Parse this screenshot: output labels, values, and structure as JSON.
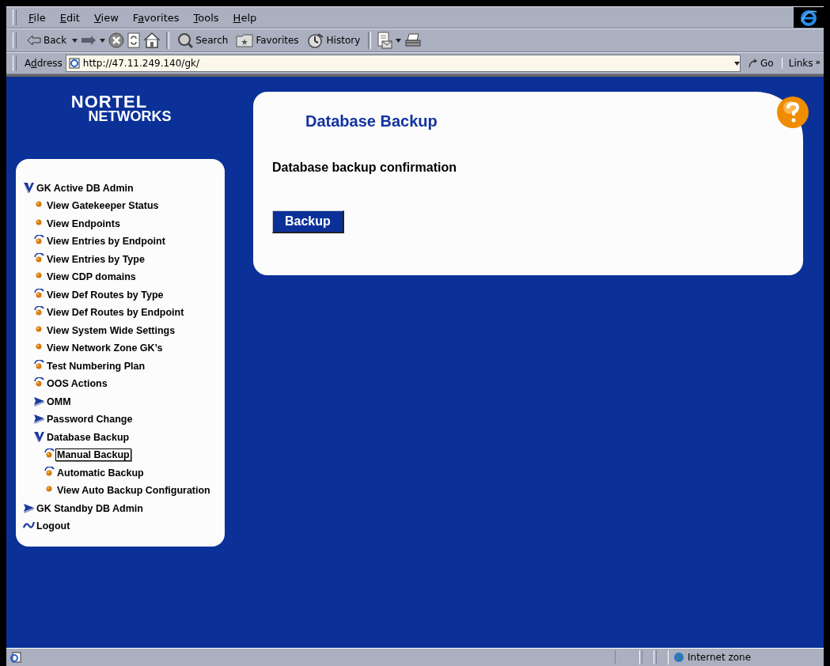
{
  "menu_bar": [
    {
      "access_key": "F",
      "rest": "ile"
    },
    {
      "access_key": "E",
      "rest": "dit"
    },
    {
      "access_key": "V",
      "rest": "iew"
    },
    {
      "before": "F",
      "access_key": "a",
      "rest": "vorites"
    },
    {
      "access_key": "T",
      "rest": "ools"
    },
    {
      "access_key": "H",
      "rest": "elp"
    }
  ],
  "toolbar": [
    {
      "kind": "back",
      "label": "Back"
    },
    {
      "kind": "forward"
    },
    {
      "kind": "stop"
    },
    {
      "kind": "refresh"
    },
    {
      "kind": "home"
    },
    {
      "kind": "separator"
    },
    {
      "kind": "search",
      "label": "Search"
    },
    {
      "kind": "favorites",
      "label": "Favorites"
    },
    {
      "kind": "history",
      "label": "History"
    },
    {
      "kind": "separator"
    },
    {
      "kind": "mail"
    },
    {
      "kind": "print"
    }
  ],
  "address_bar": {
    "before": "A",
    "access_key": "d",
    "rest": "dress",
    "value": "http://47.11.249.140/gk/",
    "go": "Go",
    "links": "Links",
    "links_more": "»"
  },
  "logo": {
    "line_1": "NORTEL",
    "line_2": "NETWORKS"
  },
  "nav": [
    {
      "label": "GK Active DB Admin",
      "kind": "folder",
      "expanded": true,
      "selected": false,
      "children": [
        {
          "label": "View Gatekeeper Status",
          "kind": "bullet",
          "selected": false
        },
        {
          "label": "View Endpoints",
          "kind": "bullet",
          "selected": false
        },
        {
          "label": "View Entries by Endpoint",
          "kind": "bullet-arc",
          "selected": false
        },
        {
          "label": "View Entries by Type",
          "kind": "bullet-arc",
          "selected": false
        },
        {
          "label": "View CDP domains",
          "kind": "bullet",
          "selected": false
        },
        {
          "label": "View Def Routes by Type",
          "kind": "bullet-arc",
          "selected": false
        },
        {
          "label": "View Def Routes by Endpoint",
          "kind": "bullet-arc",
          "selected": false
        },
        {
          "label": "View System Wide Settings",
          "kind": "bullet",
          "selected": false
        },
        {
          "label": "View Network Zone GK’s",
          "kind": "bullet",
          "selected": false
        },
        {
          "label": "Test Numbering Plan",
          "kind": "bullet-arc",
          "selected": false
        },
        {
          "label": "OOS Actions",
          "kind": "bullet-arc",
          "selected": false
        },
        {
          "label": "OMM",
          "kind": "folder",
          "expanded": false,
          "selected": false
        },
        {
          "label": "Password Change",
          "kind": "folder",
          "expanded": false,
          "selected": false
        },
        {
          "label": "Database Backup",
          "kind": "folder",
          "expanded": true,
          "selected": false,
          "children": [
            {
              "label": "Manual Backup",
              "kind": "bullet-arc",
              "selected": true
            },
            {
              "label": "Automatic Backup",
              "kind": "bullet-arc",
              "selected": false
            },
            {
              "label": "View Auto Backup Configuration",
              "kind": "bullet",
              "selected": false
            }
          ]
        }
      ]
    },
    {
      "label": "GK Standby DB Admin",
      "kind": "folder",
      "expanded": false,
      "selected": false
    },
    {
      "label": "Logout",
      "kind": "logout",
      "selected": false
    }
  ],
  "content": {
    "title": "Database Backup",
    "message": "Database backup confirmation",
    "button": "Backup"
  },
  "status_bar": {
    "zone": "Internet zone"
  }
}
